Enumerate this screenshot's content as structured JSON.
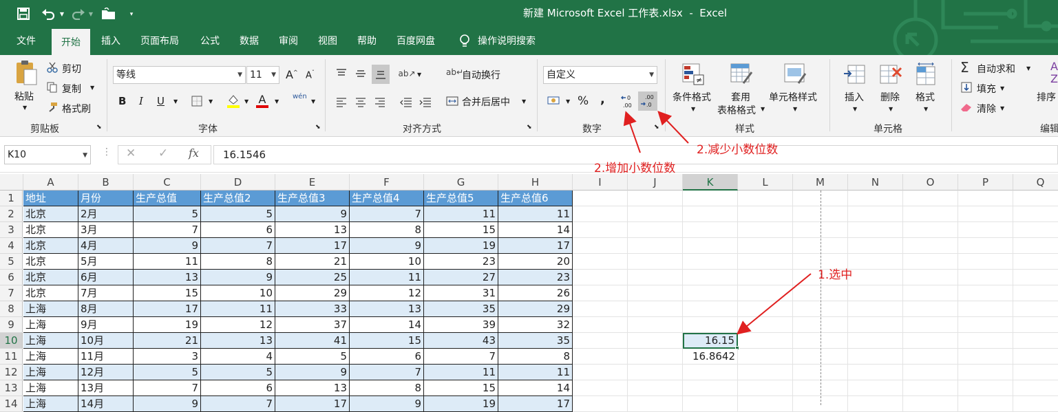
{
  "qat": {
    "undo_icon": "undo-icon",
    "redo_icon": "redo-icon"
  },
  "window": {
    "title": "新建 Microsoft Excel 工作表.xlsx  -  Excel"
  },
  "tabs": [
    "文件",
    "开始",
    "插入",
    "页面布局",
    "公式",
    "数据",
    "审阅",
    "视图",
    "帮助",
    "百度网盘"
  ],
  "tell_me": "操作说明搜索",
  "ribbon": {
    "clipboard": {
      "paste": "粘贴",
      "cut": "剪切",
      "copy": "复制",
      "format_painter": "格式刷",
      "label": "剪贴板"
    },
    "font": {
      "name": "等线",
      "size": "11",
      "bold": "B",
      "italic": "I",
      "underline": "U",
      "grow": "A",
      "shrink": "A",
      "color_letter": "A",
      "phonetic": "wén",
      "label": "字体"
    },
    "alignment": {
      "wrap": "自动换行",
      "merge": "合并后居中",
      "label": "对齐方式"
    },
    "number": {
      "format": "自定义",
      "percent": "%",
      "comma": ",",
      "label": "数字"
    },
    "styles": {
      "conditional": "条件格式",
      "table1": "套用",
      "table2": "表格格式",
      "cell_styles": "单元格样式",
      "label": "样式"
    },
    "cells": {
      "insert": "插入",
      "delete": "删除",
      "format": "格式",
      "label": "单元格"
    },
    "editing": {
      "autosum": "自动求和",
      "fill": "填充",
      "clear": "清除",
      "sort": "排序",
      "label": "编辑"
    }
  },
  "formula_bar": {
    "name_box": "K10",
    "fx": "fx",
    "value": "16.1546"
  },
  "columns": [
    "A",
    "B",
    "C",
    "D",
    "E",
    "F",
    "G",
    "H",
    "I",
    "J",
    "K",
    "L",
    "M",
    "N",
    "O",
    "P",
    "Q"
  ],
  "row_numbers": [
    "1",
    "2",
    "3",
    "4",
    "5",
    "6",
    "7",
    "8",
    "9",
    "10",
    "11",
    "12",
    "13",
    "14"
  ],
  "table": {
    "headers": [
      "地址",
      "月份",
      "生产总值",
      "生产总值2",
      "生产总值3",
      "生产总值4",
      "生产总值5",
      "生产总值6"
    ],
    "rows": [
      [
        "北京",
        "2月",
        "5",
        "5",
        "9",
        "7",
        "11",
        "11"
      ],
      [
        "北京",
        "3月",
        "7",
        "6",
        "13",
        "8",
        "15",
        "14"
      ],
      [
        "北京",
        "4月",
        "9",
        "7",
        "17",
        "9",
        "19",
        "17"
      ],
      [
        "北京",
        "5月",
        "11",
        "8",
        "21",
        "10",
        "23",
        "20"
      ],
      [
        "北京",
        "6月",
        "13",
        "9",
        "25",
        "11",
        "27",
        "23"
      ],
      [
        "北京",
        "7月",
        "15",
        "10",
        "29",
        "12",
        "31",
        "26"
      ],
      [
        "上海",
        "8月",
        "17",
        "11",
        "33",
        "13",
        "35",
        "29"
      ],
      [
        "上海",
        "9月",
        "19",
        "12",
        "37",
        "14",
        "39",
        "32"
      ],
      [
        "上海",
        "10月",
        "21",
        "13",
        "41",
        "15",
        "43",
        "35"
      ],
      [
        "上海",
        "11月",
        "3",
        "4",
        "5",
        "6",
        "7",
        "8"
      ],
      [
        "上海",
        "12月",
        "5",
        "5",
        "9",
        "7",
        "11",
        "11"
      ],
      [
        "上海",
        "13月",
        "7",
        "6",
        "13",
        "8",
        "15",
        "14"
      ],
      [
        "上海",
        "14月",
        "9",
        "7",
        "17",
        "9",
        "19",
        "17"
      ]
    ]
  },
  "k10": "16.15",
  "k11": "16.8642",
  "annotations": {
    "select": "1.选中",
    "increase": "2.增加小数位数",
    "decrease": "2.减少小数位数"
  },
  "colors": {
    "excel_green": "#217346",
    "header_blue": "#5b9bd5",
    "band_blue": "#ddebf7",
    "annotation_red": "#e02020"
  }
}
